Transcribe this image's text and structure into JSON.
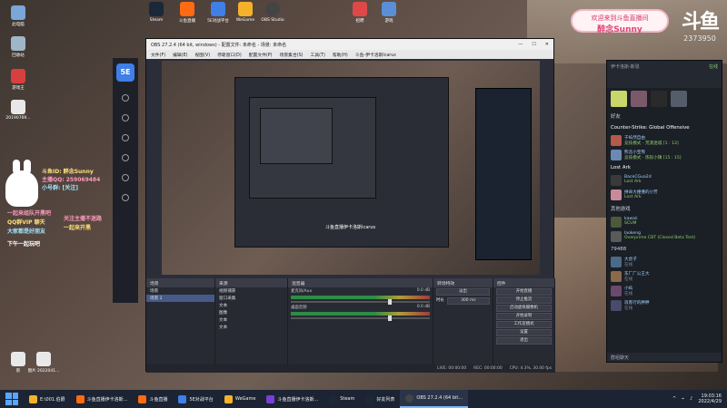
{
  "desktop_icons": [
    {
      "label": "此电脑",
      "color": "#7aa6d8"
    },
    {
      "label": "回收站",
      "color": "#9fb6c8"
    },
    {
      "label": "游戏王",
      "color": "#d84040"
    },
    {
      "label": "20190769...",
      "color": "#e8e8e8"
    },
    {
      "label": "新",
      "color": "#e8e8e8"
    },
    {
      "label": "图片 2022041...",
      "color": "#e8e8e8"
    },
    {
      "label": "Steam",
      "color": "#1b2838"
    },
    {
      "label": "斗鱼直播",
      "color": "#ff6a13"
    },
    {
      "label": "5E对战平台",
      "color": "#3f7fe6"
    },
    {
      "label": "WeGame",
      "color": "#f3b22a"
    },
    {
      "label": "OBS Studio",
      "color": "#444"
    },
    {
      "label": "招聘",
      "color": "#e04848"
    },
    {
      "label": "游戏",
      "color": "#5a8fd8"
    }
  ],
  "badge": {
    "line1": "欢迎来到斗鱼直播间",
    "line2": "醉念Sunny"
  },
  "douyu": {
    "logo": "斗鱼",
    "room_number": "2373950"
  },
  "overlay": {
    "lines": [
      "斗鱼ID: 醉念Sunny",
      "主播QQ: 259069484",
      "小号群: [关注]",
      "一起来组队开黑吧",
      "QQ群VIP 聊天",
      "大家都是好朋友",
      "关注主播不迷路",
      "一起来开黑",
      "下午一起玩吧"
    ]
  },
  "obs": {
    "title": "OBS 27.2.4 (64 bit, windows) - 配置文件: 未命名 - 场景: 未命名",
    "menu": [
      "文件(F)",
      "编辑(E)",
      "视图(V)",
      "停靠窗口(D)",
      "配置文件(P)",
      "场景集合(S)",
      "工具(T)",
      "帮助(H)",
      "斗鱼-伊卡洛斯Icarus"
    ],
    "preview_caption": "斗鱼直播伊卡洛斯Icarus",
    "docks": {
      "scenes": {
        "title": "场景",
        "items": [
          "场景",
          "场景 2"
        ],
        "selected": 1
      },
      "sources": {
        "title": "来源",
        "items": [
          "视频捕获",
          "窗口采集",
          "文本",
          "图像",
          "文本",
          "文本"
        ]
      },
      "mixer": {
        "title": "混音器",
        "channels": [
          {
            "name": "麦克风/Aux",
            "db": "0.0 dB"
          },
          {
            "name": "桌面音频",
            "db": "0.0 dB"
          }
        ]
      },
      "transitions": {
        "title": "转场特效",
        "type": "淡出",
        "duration_label": "时长",
        "duration": "300 ms"
      },
      "controls": {
        "title": "控件",
        "buttons": [
          "开始直播",
          "停止推流",
          "启动虚拟摄像机",
          "开始录制",
          "工作室模式",
          "设置",
          "退出"
        ]
      }
    },
    "status": {
      "live": "LIVE: 00:00:00",
      "rec": "REC: 00:00:00",
      "cpu": "CPU: 4.3%, 30.00 fps"
    }
  },
  "steam": {
    "user": "伊卡洛斯-斯恩",
    "status": "在线",
    "section_friends": "好友",
    "groups": [
      {
        "game": "Counter-Strike: Global Offensive",
        "friends": [
          {
            "name": "于屿然自由",
            "sub": "竞技模式 - 荒漠迷城 [1 : 13]"
          },
          {
            "name": "熊念小宝熊",
            "sub": "竞技模式 - 炼狱小镇 [15 : 15]"
          }
        ]
      },
      {
        "game": "Lost Ark",
        "friends": [
          {
            "name": "BaceCGua2d",
            "sub": "Lost Ark"
          },
          {
            "name": "拼命大撞撞的小芳",
            "sub": "Lost Ark"
          }
        ]
      }
    ],
    "section_other": "其他游戏",
    "other": [
      {
        "name": "kawaii",
        "sub": "SCUM"
      },
      {
        "name": "laokeng",
        "sub": "Overprime CBT (Closed Beta Test)"
      }
    ],
    "count": "79488",
    "more": [
      {
        "name": "大虎子",
        "sub": "在线"
      },
      {
        "name": "东厂厂公王大",
        "sub": "在线"
      },
      {
        "name": "小屿",
        "sub": "在线"
      },
      {
        "name": "浪客行的胖胖",
        "sub": "在线"
      }
    ],
    "footer": "群组聊天"
  },
  "taskbar": {
    "items": [
      {
        "label": "E:\\001.伯爵",
        "color": "#f3b22a"
      },
      {
        "label": "斗鱼直播伊卡洛斯...",
        "color": "#ff6a13"
      },
      {
        "label": "斗鱼直播",
        "color": "#ff6a13"
      },
      {
        "label": "5E对战平台",
        "color": "#3f7fe6"
      },
      {
        "label": "WeGame",
        "color": "#f3b22a"
      },
      {
        "label": "斗鱼直播伊卡洛斯...",
        "color": "#7a3fd6"
      },
      {
        "label": "Steam",
        "color": "#1b2838"
      },
      {
        "label": "好友列表",
        "color": "#1b2838"
      },
      {
        "label": "OBS 27.2.4 (64 bit...",
        "color": "#444"
      }
    ],
    "active_index": 8,
    "time": "19:03:16",
    "date": "2022/4/29"
  }
}
